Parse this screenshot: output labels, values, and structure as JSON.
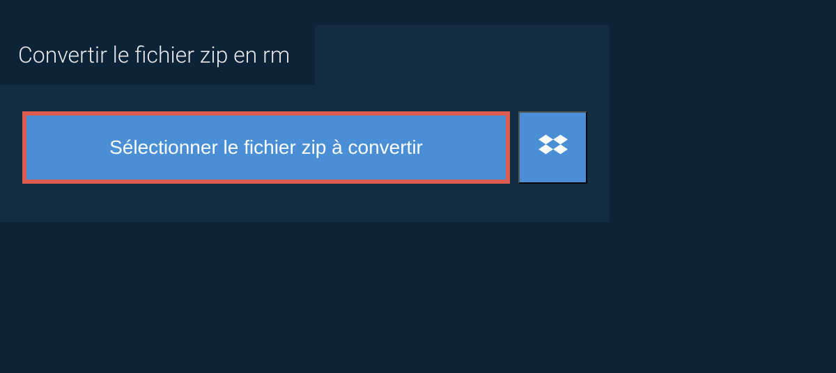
{
  "tab": {
    "title": "Convertir le fichier zip en rm"
  },
  "buttons": {
    "select_file_label": "Sélectionner le fichier zip à convertir"
  },
  "icons": {
    "dropbox": "dropbox-icon"
  },
  "colors": {
    "background_outer": "#0d2438",
    "background_panel": "#122d42",
    "button_primary": "#4a8fd6",
    "highlight_border": "#dc5c50",
    "text_light": "#ffffff"
  }
}
